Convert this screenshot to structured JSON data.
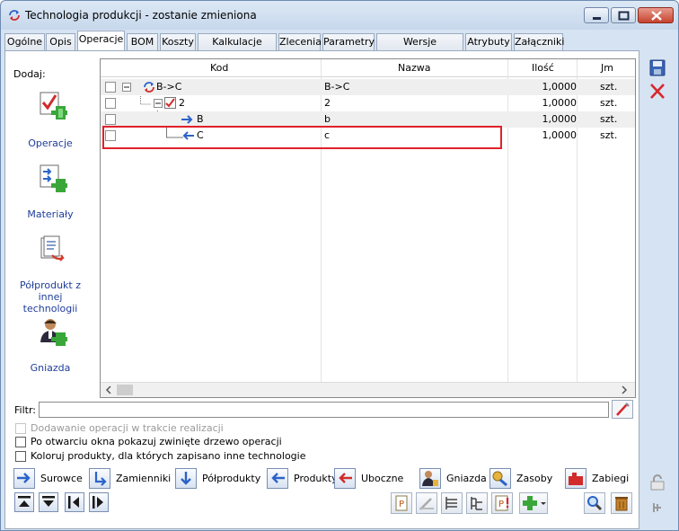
{
  "window": {
    "title": "Technologia produkcji - zostanie zmieniona"
  },
  "tabs": [
    {
      "label": "Ogólne"
    },
    {
      "label": "Opis"
    },
    {
      "label": "Operacje"
    },
    {
      "label": "BOM"
    },
    {
      "label": "Koszty"
    },
    {
      "label": "Kalkulacje kosztu"
    },
    {
      "label": "Zlecenia"
    },
    {
      "label": "Parametry"
    },
    {
      "label": "Wersje technologii"
    },
    {
      "label": "Atrybuty"
    },
    {
      "label": "Załączniki"
    }
  ],
  "active_tab": "Operacje",
  "sidebar": {
    "title": "Dodaj:",
    "items": [
      {
        "label": "Operacje",
        "icon": "add-operation-icon"
      },
      {
        "label": "Materiały",
        "icon": "add-material-icon"
      },
      {
        "label_line1": "Półprodukt z",
        "label_line2": "innej technologii",
        "icon": "semi-product-icon"
      },
      {
        "label": "Gniazda",
        "icon": "workstation-icon"
      }
    ]
  },
  "tree": {
    "columns": {
      "kod": "Kod",
      "nazwa": "Nazwa",
      "ilosc": "Ilość",
      "jm": "Jm"
    },
    "rows": [
      {
        "kod": "B->C",
        "nazwa": "B->C",
        "ilosc": "1,0000",
        "jm": "szt.",
        "icon": "technology-cycle-icon"
      },
      {
        "kod": "2",
        "nazwa": "2",
        "ilosc": "1,0000",
        "jm": "szt.",
        "icon": "operation-check-icon"
      },
      {
        "kod": "B",
        "nazwa": "b",
        "ilosc": "1,0000",
        "jm": "szt.",
        "icon": "arrow-right-icon"
      },
      {
        "kod": "C",
        "nazwa": "c",
        "ilosc": "1,0000",
        "jm": "szt.",
        "icon": "arrow-left-icon"
      }
    ],
    "highlighted_row": "C"
  },
  "filter": {
    "label": "Filtr:",
    "value": ""
  },
  "options": [
    {
      "label": "Dodawanie operacji w trakcie realizacji",
      "checked": false,
      "disabled": true
    },
    {
      "label": "Po otwarciu okna pokazuj zwinięte drzewo operacji",
      "checked": false,
      "disabled": false
    },
    {
      "label": "Koloruj produkty, dla których zapisano inne technologie",
      "checked": false,
      "disabled": false
    }
  ],
  "legend_buttons": [
    {
      "label": "Surowce"
    },
    {
      "label": "Zamienniki"
    },
    {
      "label": "Półprodukty"
    },
    {
      "label": "Produkty"
    },
    {
      "label": "Uboczne"
    },
    {
      "label": "Gniazda"
    },
    {
      "label": "Zasoby"
    },
    {
      "label": "Zabiegi"
    }
  ],
  "colors": {
    "accent_blue": "#2b63c8",
    "highlight_red": "#e0212b",
    "add_green": "#3aa63a",
    "link_text": "#1f3d99"
  }
}
